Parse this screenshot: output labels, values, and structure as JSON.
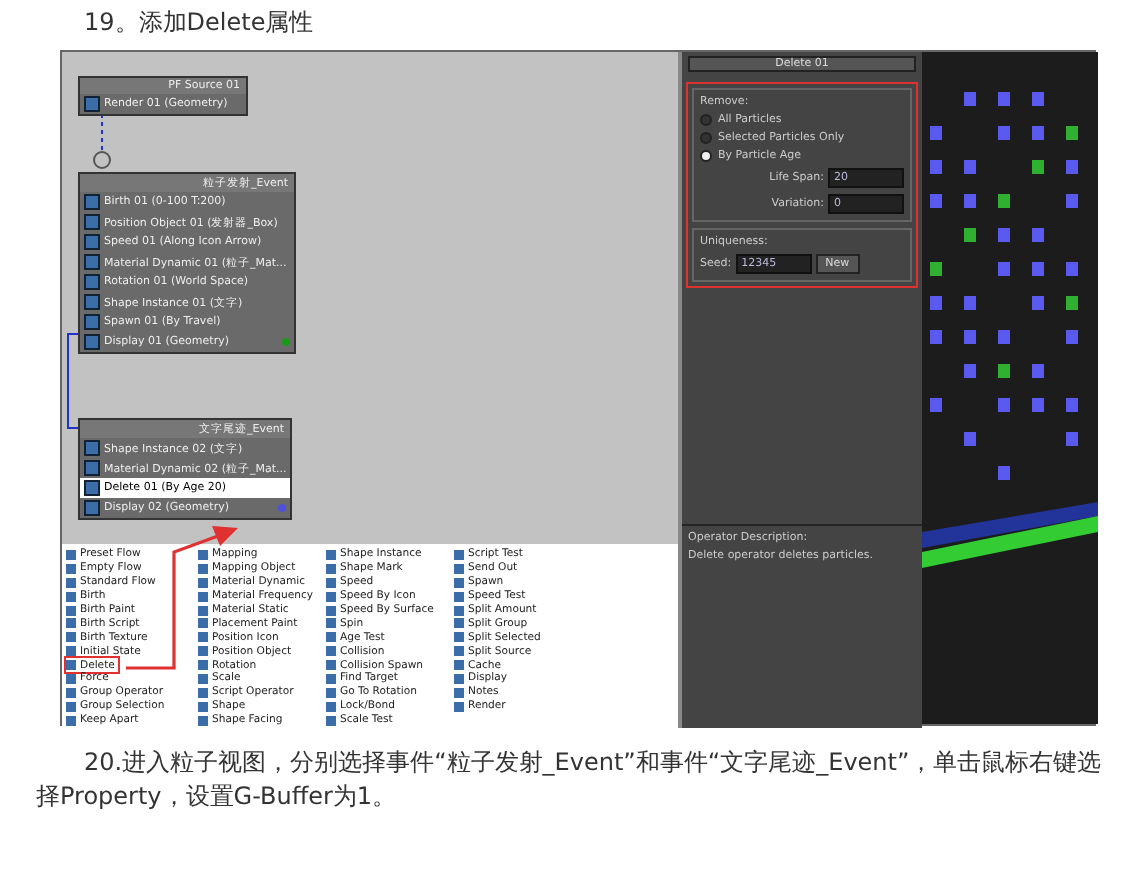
{
  "heading": "19。添加Delete属性",
  "screenshot": {
    "graph": {
      "events": [
        {
          "title": "PF Source 01",
          "operators": [
            {
              "label": "Render 01 (Geometry)",
              "selected": false
            }
          ]
        },
        {
          "title": "粒子发射_Event",
          "color": "#1a9a1a",
          "operators": [
            {
              "label": "Birth 01 (0-100 T:200)",
              "selected": false
            },
            {
              "label": "Position Object 01 (发射器_Box)",
              "selected": false
            },
            {
              "label": "Speed 01 (Along Icon Arrow)",
              "selected": false
            },
            {
              "label": "Material Dynamic 01 (粒子_Mat...",
              "selected": false
            },
            {
              "label": "Rotation 01 (World Space)",
              "selected": false
            },
            {
              "label": "Shape Instance 01 (文字)",
              "selected": false
            },
            {
              "label": "Spawn 01 (By Travel)",
              "selected": false
            },
            {
              "label": "Display 01 (Geometry)",
              "selected": false
            }
          ]
        },
        {
          "title": "文字尾迹_Event",
          "color": "#5050e0",
          "operators": [
            {
              "label": "Shape Instance 02 (文字)",
              "selected": false
            },
            {
              "label": "Material Dynamic 02 (粒子_Mat...",
              "selected": false
            },
            {
              "label": "Delete 01 (By Age 20)",
              "selected": true
            },
            {
              "label": "Display 02 (Geometry)",
              "selected": false
            }
          ]
        }
      ]
    },
    "depot": [
      [
        {
          "label": "Preset Flow",
          "selected": false
        },
        {
          "label": "Empty Flow",
          "selected": false
        },
        {
          "label": "Standard Flow",
          "selected": false
        },
        {
          "label": "Birth",
          "selected": false
        },
        {
          "label": "Birth Paint",
          "selected": false
        },
        {
          "label": "Birth Script",
          "selected": false
        },
        {
          "label": "Birth Texture",
          "selected": false
        },
        {
          "label": "Initial State",
          "selected": false
        },
        {
          "label": "Delete",
          "selected": true
        },
        {
          "label": "Force",
          "selected": false
        },
        {
          "label": "Group Operator",
          "selected": false
        },
        {
          "label": "Group Selection",
          "selected": false
        },
        {
          "label": "Keep Apart",
          "selected": false
        }
      ],
      [
        {
          "label": "Mapping",
          "selected": false
        },
        {
          "label": "Mapping Object",
          "selected": false
        },
        {
          "label": "Material Dynamic",
          "selected": false
        },
        {
          "label": "Material Frequency",
          "selected": false
        },
        {
          "label": "Material Static",
          "selected": false
        },
        {
          "label": "Placement Paint",
          "selected": false
        },
        {
          "label": "Position Icon",
          "selected": false
        },
        {
          "label": "Position Object",
          "selected": false
        },
        {
          "label": "Rotation",
          "selected": false
        },
        {
          "label": "Scale",
          "selected": false
        },
        {
          "label": "Script Operator",
          "selected": false
        },
        {
          "label": "Shape",
          "selected": false
        },
        {
          "label": "Shape Facing",
          "selected": false
        }
      ],
      [
        {
          "label": "Shape Instance",
          "selected": false
        },
        {
          "label": "Shape Mark",
          "selected": false
        },
        {
          "label": "Speed",
          "selected": false
        },
        {
          "label": "Speed By Icon",
          "selected": false
        },
        {
          "label": "Speed By Surface",
          "selected": false
        },
        {
          "label": "Spin",
          "selected": false
        },
        {
          "label": "Age Test",
          "selected": false
        },
        {
          "label": "Collision",
          "selected": false
        },
        {
          "label": "Collision Spawn",
          "selected": false
        },
        {
          "label": "Find Target",
          "selected": false
        },
        {
          "label": "Go To Rotation",
          "selected": false
        },
        {
          "label": "Lock/Bond",
          "selected": false
        },
        {
          "label": "Scale Test",
          "selected": false
        }
      ],
      [
        {
          "label": "Script Test",
          "selected": false
        },
        {
          "label": "Send Out",
          "selected": false
        },
        {
          "label": "Spawn",
          "selected": false
        },
        {
          "label": "Speed Test",
          "selected": false
        },
        {
          "label": "Split Amount",
          "selected": false
        },
        {
          "label": "Split Group",
          "selected": false
        },
        {
          "label": "Split Selected",
          "selected": false
        },
        {
          "label": "Split Source",
          "selected": false
        },
        {
          "label": "Cache",
          "selected": false
        },
        {
          "label": "Display",
          "selected": false
        },
        {
          "label": "Notes",
          "selected": false
        },
        {
          "label": "Render",
          "selected": false
        }
      ]
    ],
    "panel": {
      "rollout_title": "Delete 01",
      "remove_label": "Remove:",
      "options": [
        {
          "label": "All Particles",
          "selected": false
        },
        {
          "label": "Selected Particles Only",
          "selected": false
        },
        {
          "label": "By Particle Age",
          "selected": true
        }
      ],
      "life_span": {
        "label": "Life Span:",
        "value": "20"
      },
      "variation": {
        "label": "Variation:",
        "value": "0"
      },
      "uniqueness_label": "Uniqueness:",
      "seed": {
        "label": "Seed:",
        "value": "12345"
      },
      "new_button": "New",
      "description_label": "Operator Description:",
      "description": "Delete operator deletes particles."
    }
  },
  "paragraph": "20.进入粒子视图，分别选择事件“粒子发射_Event”和事件“文字尾迹_Event”，单击鼠标右键选择Property，设置G-Buffer为1。"
}
